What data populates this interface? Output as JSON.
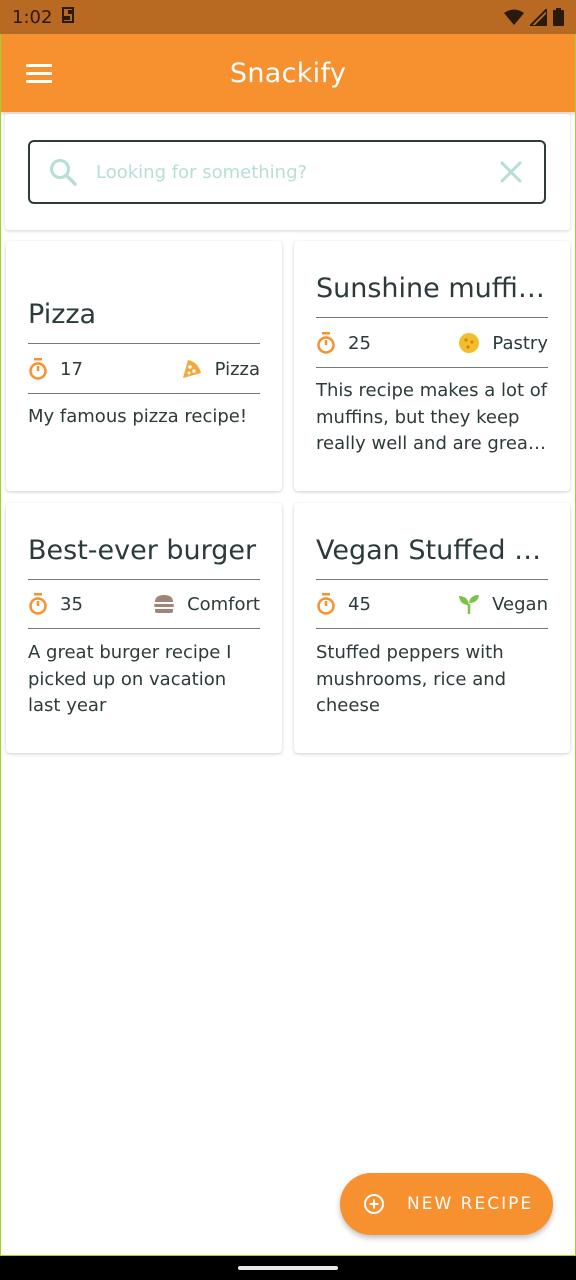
{
  "status_bar": {
    "time": "1:02"
  },
  "app_bar": {
    "title": "Snackify"
  },
  "search": {
    "placeholder": "Looking for something?",
    "value": ""
  },
  "recipes": [
    {
      "title": "Pizza",
      "time": "17",
      "category": "Pizza",
      "category_icon": "pizza-icon",
      "description": "My famous pizza recipe!"
    },
    {
      "title": "Sunshine muffins",
      "time": "25",
      "category": "Pastry",
      "category_icon": "cookie-icon",
      "description": "This recipe makes a lot of muffins, but they keep really well and are great for sharing"
    },
    {
      "title": "Best-ever burger",
      "time": "35",
      "category": "Comfort",
      "category_icon": "burger-icon",
      "description": "A great burger recipe I picked up on vacation last year"
    },
    {
      "title": "Vegan Stuffed Peppers",
      "time": "45",
      "category": "Vegan",
      "category_icon": "sprout-icon",
      "description": "Stuffed peppers with mushrooms, rice and cheese"
    }
  ],
  "fab": {
    "label": "NEW RECIPE"
  },
  "colors": {
    "accent": "#f7902e",
    "status_bar": "#b86a22",
    "teal": "#b5dfd6",
    "text": "#2b3a3a",
    "pizza": "#f2a83b",
    "cookie": "#f3bd2e",
    "burger": "#a08478",
    "sprout": "#7cc243"
  }
}
